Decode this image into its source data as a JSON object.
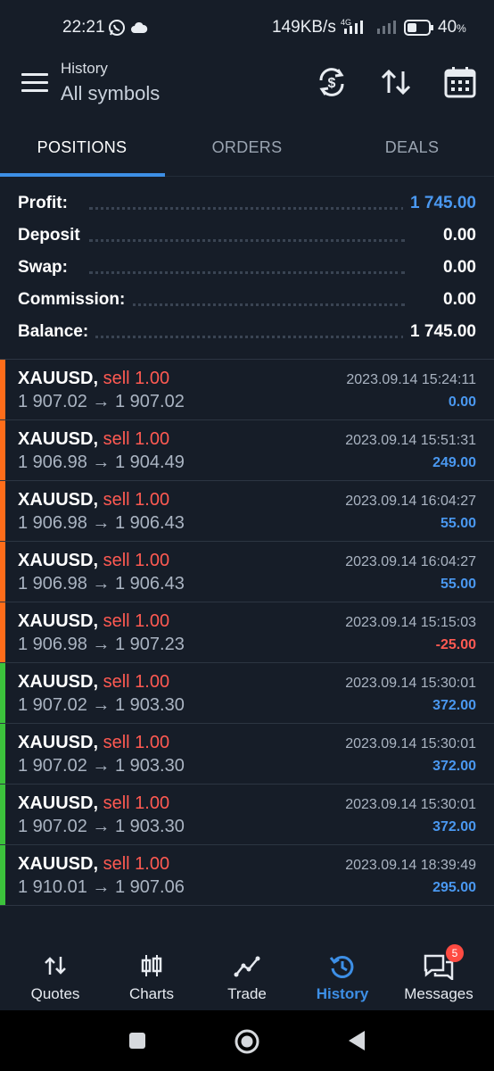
{
  "status_bar": {
    "time": "22:21",
    "speed": "149KB/s",
    "network": "4G",
    "battery": "40",
    "battery_unit": "%"
  },
  "header": {
    "subtitle": "History",
    "title": "All symbols"
  },
  "tabs": [
    {
      "label": "POSITIONS",
      "active": true
    },
    {
      "label": "ORDERS",
      "active": false
    },
    {
      "label": "DEALS",
      "active": false
    }
  ],
  "summary": [
    {
      "label": "Profit:",
      "value": "1 745.00",
      "highlight": true
    },
    {
      "label": "Deposit",
      "value": "0.00",
      "highlight": false
    },
    {
      "label": "Swap:",
      "value": "0.00",
      "highlight": false
    },
    {
      "label": "Commission:",
      "value": "0.00",
      "highlight": false
    },
    {
      "label": "Balance:",
      "value": "1 745.00",
      "highlight": false
    }
  ],
  "positions": [
    {
      "symbol": "XAUUSD,",
      "side": "sell 1.00",
      "prices": "1 907.02 → 1 907.02",
      "time": "2023.09.14 15:24:11",
      "profit": "0.00",
      "bar": "#ff6d1a"
    },
    {
      "symbol": "XAUUSD,",
      "side": "sell 1.00",
      "prices": "1 906.98 → 1 904.49",
      "time": "2023.09.14 15:51:31",
      "profit": "249.00",
      "bar": "#ff6d1a"
    },
    {
      "symbol": "XAUUSD,",
      "side": "sell 1.00",
      "prices": "1 906.98 → 1 906.43",
      "time": "2023.09.14 16:04:27",
      "profit": "55.00",
      "bar": "#ff6d1a"
    },
    {
      "symbol": "XAUUSD,",
      "side": "sell 1.00",
      "prices": "1 906.98 → 1 906.43",
      "time": "2023.09.14 16:04:27",
      "profit": "55.00",
      "bar": "#ff6d1a"
    },
    {
      "symbol": "XAUUSD,",
      "side": "sell 1.00",
      "prices": "1 906.98 → 1 907.23",
      "time": "2023.09.14 15:15:03",
      "profit": "-25.00",
      "bar": "#ff6d1a"
    },
    {
      "symbol": "XAUUSD,",
      "side": "sell 1.00",
      "prices": "1 907.02 → 1 903.30",
      "time": "2023.09.14 15:30:01",
      "profit": "372.00",
      "bar": "#3cc23c"
    },
    {
      "symbol": "XAUUSD,",
      "side": "sell 1.00",
      "prices": "1 907.02 → 1 903.30",
      "time": "2023.09.14 15:30:01",
      "profit": "372.00",
      "bar": "#3cc23c"
    },
    {
      "symbol": "XAUUSD,",
      "side": "sell 1.00",
      "prices": "1 907.02 → 1 903.30",
      "time": "2023.09.14 15:30:01",
      "profit": "372.00",
      "bar": "#3cc23c"
    },
    {
      "symbol": "XAUUSD,",
      "side": "sell 1.00",
      "prices": "1 910.01 → 1 907.06",
      "time": "2023.09.14 18:39:49",
      "profit": "295.00",
      "bar": "#3cc23c"
    }
  ],
  "bottom_nav": [
    {
      "label": "Quotes",
      "icon": "quotes-icon",
      "active": false
    },
    {
      "label": "Charts",
      "icon": "charts-icon",
      "active": false
    },
    {
      "label": "Trade",
      "icon": "trade-icon",
      "active": false
    },
    {
      "label": "History",
      "icon": "history-icon",
      "active": true
    },
    {
      "label": "Messages",
      "icon": "messages-icon",
      "active": false
    }
  ],
  "messages_badge": "5",
  "colors": {
    "accent": "#3d8fe6",
    "profit_positive": "#4a98f0",
    "sell": "#ff5a52",
    "background": "#161d28"
  }
}
